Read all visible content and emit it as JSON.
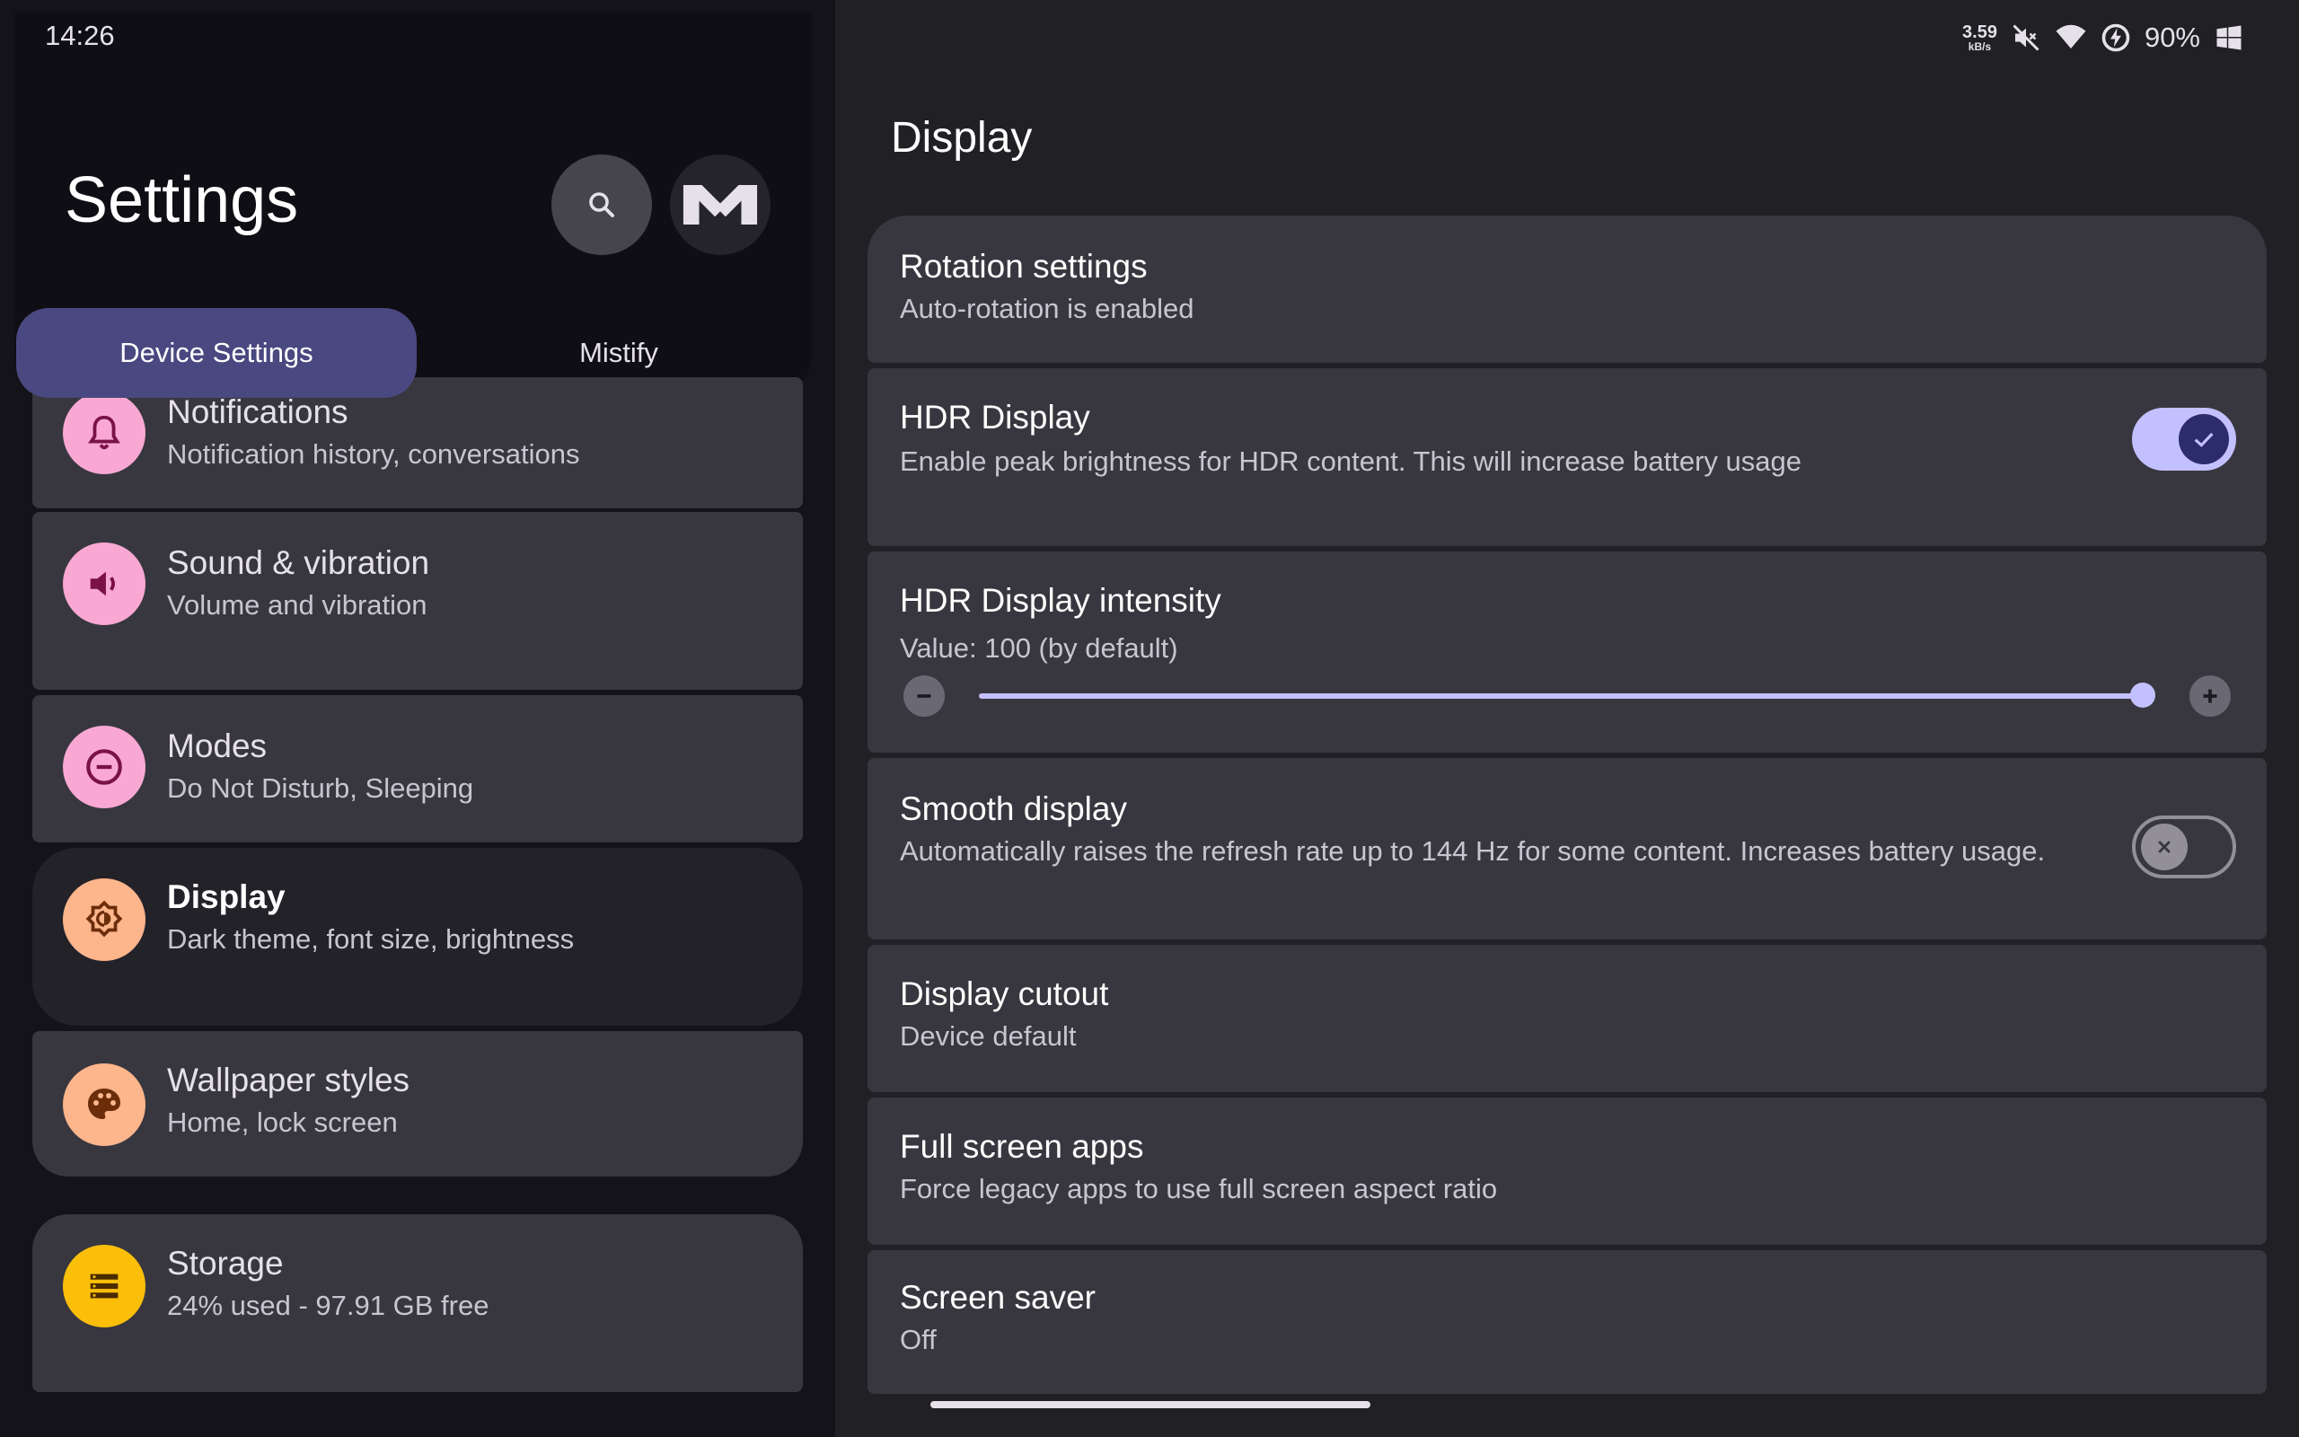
{
  "status_bar": {
    "time": "14:26",
    "net_speed_value": "3.59",
    "net_speed_unit": "kB/s",
    "battery": "90%"
  },
  "left": {
    "title": "Settings",
    "tabs": [
      {
        "label": "Device Settings",
        "selected": true
      },
      {
        "label": "Mistify",
        "selected": false
      }
    ],
    "items": [
      {
        "title": "Notifications",
        "subtitle": "Notification history, conversations",
        "icon": "bell-icon",
        "color": "#f9a8d4"
      },
      {
        "title": "Sound & vibration",
        "subtitle": "Volume and vibration",
        "icon": "speaker-icon",
        "color": "#f9a8d4"
      },
      {
        "title": "Modes",
        "subtitle": "Do Not Disturb, Sleeping",
        "icon": "minus-circle-icon",
        "color": "#f9a8d4"
      },
      {
        "title": "Display",
        "subtitle": "Dark theme, font size, brightness",
        "icon": "brightness-icon",
        "color": "#fdb58c",
        "selected": true
      },
      {
        "title": "Wallpaper styles",
        "subtitle": "Home, lock screen",
        "icon": "palette-icon",
        "color": "#fdb58c"
      },
      {
        "title": "Storage",
        "subtitle": "24% used - 97.91 GB free",
        "icon": "storage-icon",
        "color": "#fbbf0a"
      }
    ]
  },
  "right": {
    "title": "Display",
    "rotation": {
      "title": "Rotation settings",
      "subtitle": "Auto-rotation is enabled"
    },
    "hdr": {
      "title": "HDR Display",
      "subtitle": "Enable peak brightness for HDR content. This will increase battery usage",
      "enabled": true
    },
    "hdr_intensity": {
      "title": "HDR Display intensity",
      "subtitle": "Value: 100 (by default)",
      "value": 100,
      "max": 100
    },
    "smooth": {
      "title": "Smooth display",
      "subtitle": "Automatically raises the refresh rate up to 144 Hz for some content. Increases battery usage.",
      "enabled": false
    },
    "cutout": {
      "title": "Display cutout",
      "subtitle": "Device default"
    },
    "fullscreen": {
      "title": "Full screen apps",
      "subtitle": "Force legacy apps to use full screen aspect ratio"
    },
    "screensaver": {
      "title": "Screen saver",
      "subtitle": "Off"
    }
  },
  "colors": {
    "accent": "#c3c0ff",
    "tab_selected": "#4a4880",
    "card": "#38373f"
  }
}
